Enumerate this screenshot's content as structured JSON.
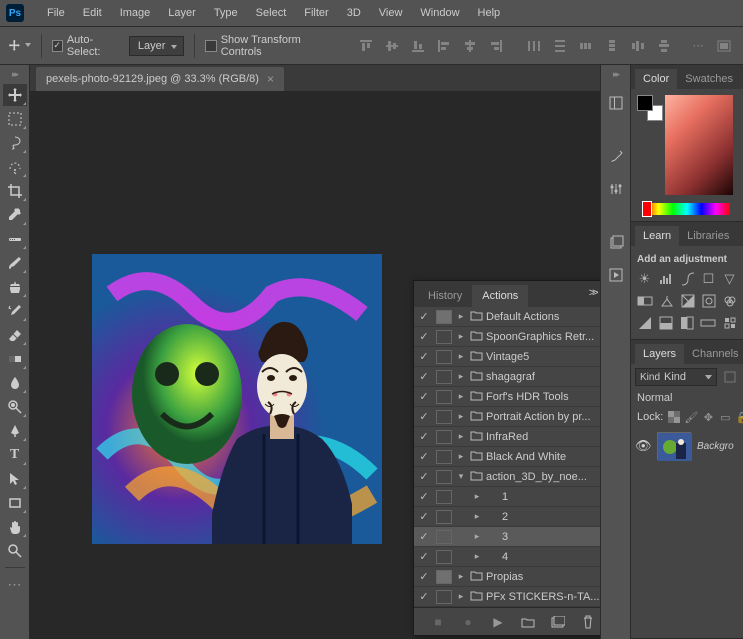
{
  "menubar": {
    "items": [
      "File",
      "Edit",
      "Image",
      "Layer",
      "Type",
      "Select",
      "Filter",
      "3D",
      "View",
      "Window",
      "Help"
    ]
  },
  "optionsbar": {
    "auto_select_label": "Auto-Select:",
    "auto_select_target": "Layer",
    "show_transform_label": "Show Transform Controls"
  },
  "document": {
    "tab_title": "pexels-photo-92129.jpeg @ 33.3% (RGB/8)"
  },
  "actions_panel": {
    "tabs": [
      "History",
      "Actions"
    ],
    "active_tab": 1,
    "rows": [
      {
        "check": true,
        "box": true,
        "twist": "right",
        "folder": true,
        "label": "Default Actions",
        "indent": 0
      },
      {
        "check": true,
        "box": false,
        "twist": "right",
        "folder": true,
        "label": "SpoonGraphics Retr...",
        "indent": 0
      },
      {
        "check": true,
        "box": false,
        "twist": "right",
        "folder": true,
        "label": "Vintage5",
        "indent": 0
      },
      {
        "check": true,
        "box": false,
        "twist": "right",
        "folder": true,
        "label": "shagagraf",
        "indent": 0
      },
      {
        "check": true,
        "box": false,
        "twist": "right",
        "folder": true,
        "label": "Forf's HDR Tools",
        "indent": 0
      },
      {
        "check": true,
        "box": false,
        "twist": "right",
        "folder": true,
        "label": "Portrait Action by pr...",
        "indent": 0
      },
      {
        "check": true,
        "box": false,
        "twist": "right",
        "folder": true,
        "label": "InfraRed",
        "indent": 0
      },
      {
        "check": true,
        "box": false,
        "twist": "right",
        "folder": true,
        "label": "Black And White",
        "indent": 0
      },
      {
        "check": true,
        "box": false,
        "twist": "down",
        "folder": true,
        "label": "action_3D_by_noe...",
        "indent": 0
      },
      {
        "check": true,
        "box": false,
        "twist": "right",
        "folder": false,
        "label": "1",
        "indent": 1
      },
      {
        "check": true,
        "box": false,
        "twist": "right",
        "folder": false,
        "label": "2",
        "indent": 1
      },
      {
        "check": true,
        "box": false,
        "twist": "right",
        "folder": false,
        "label": "3",
        "indent": 1,
        "selected": true
      },
      {
        "check": true,
        "box": false,
        "twist": "right",
        "folder": false,
        "label": "4",
        "indent": 1
      },
      {
        "check": true,
        "box": true,
        "twist": "right",
        "folder": true,
        "label": "Propias",
        "indent": 0
      },
      {
        "check": true,
        "box": false,
        "twist": "right",
        "folder": true,
        "label": "PFx STICKERS-n-TA...",
        "indent": 0
      }
    ]
  },
  "right_panels": {
    "color_tabs": [
      "Color",
      "Swatches"
    ],
    "learn_tabs": [
      "Learn",
      "Libraries"
    ],
    "adjustments_title": "Add an adjustment",
    "layers_tabs": [
      "Layers",
      "Channels"
    ],
    "kind_label": "Kind",
    "blend_mode": "Normal",
    "lock_label": "Lock:",
    "layer_name": "Backgro"
  },
  "search_icon_label": "⌕"
}
